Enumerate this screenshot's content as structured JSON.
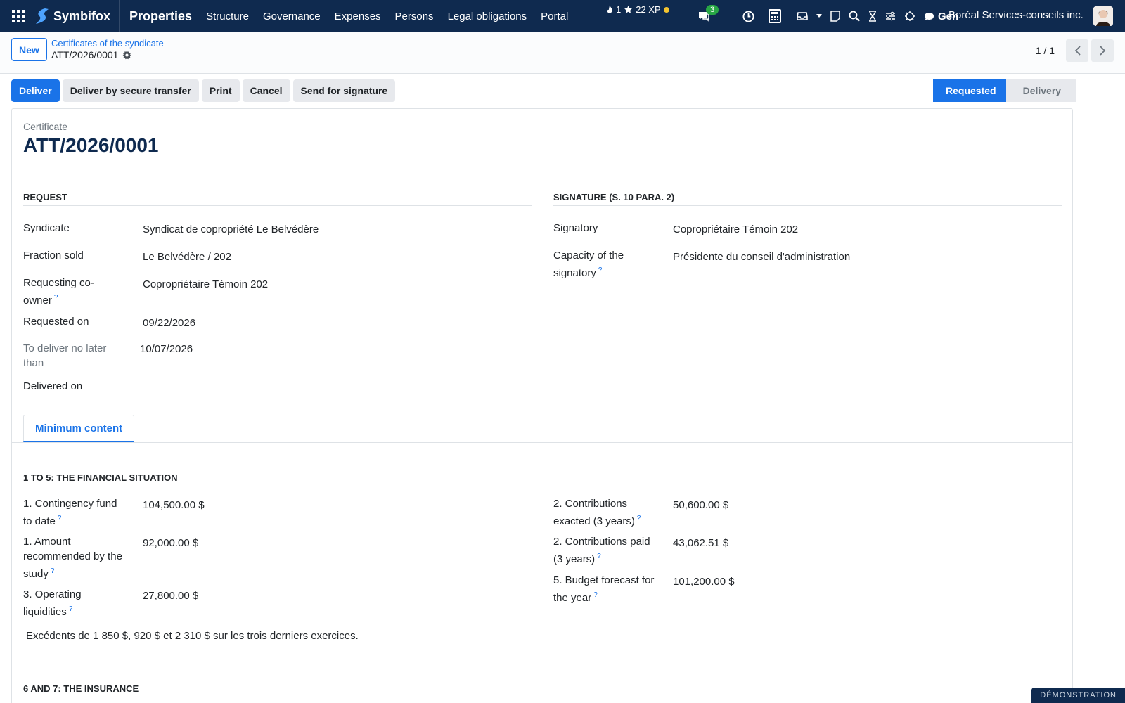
{
  "nav": {
    "brand": "Symbifox",
    "app_name": "Properties",
    "menu": [
      "Structure",
      "Governance",
      "Expenses",
      "Persons",
      "Legal obligations",
      "Portal"
    ],
    "xp_count": "1",
    "xp_points": "22 XP",
    "chat_badge": "3",
    "gen_label": "Gen",
    "company": "Boréal Services-conseils inc."
  },
  "control": {
    "new_label": "New",
    "breadcrumb_parent": "Certificates of the syndicate",
    "breadcrumb_current": "ATT/2026/0001",
    "pager": "1 / 1"
  },
  "statusbar": {
    "buttons": [
      "Deliver",
      "Deliver by secure transfer",
      "Print",
      "Cancel",
      "Send for signature"
    ],
    "stages": [
      "Requested",
      "Delivery"
    ]
  },
  "record": {
    "label": "Certificate",
    "title": "ATT/2026/0001"
  },
  "request": {
    "heading": "Request",
    "syndicate_label": "Syndicate",
    "syndicate_value": "Syndicat de copropriété Le Belvédère",
    "fraction_label": "Fraction sold",
    "fraction_value": "Le Belvédère / 202",
    "coowner_label_1": "Requesting co-",
    "coowner_label_2": "owner",
    "coowner_value": "Copropriétaire Témoin 202",
    "requested_label": "Requested on",
    "requested_value": "09/22/2026",
    "deliver_by_label_1": "To deliver no later",
    "deliver_by_label_2": "than",
    "deliver_by_value": "10/07/2026",
    "delivered_label": "Delivered on"
  },
  "signature": {
    "heading": "Signature (s. 10 para. 2)",
    "signatory_label": "Signatory",
    "signatory_value": "Copropriétaire Témoin 202",
    "capacity_label_1": "Capacity of the",
    "capacity_label_2": "signatory",
    "capacity_value": "Présidente du conseil d'administration"
  },
  "tabs": {
    "minimum_content": "Minimum content"
  },
  "financial": {
    "heading": "1 to 5: The financial situation",
    "f1_label_1": "1. Contingency fund",
    "f1_label_2": "to date",
    "f1_value": "104,500.00 $",
    "f2_label_1": "1. Amount",
    "f2_label_2": "recommended by the",
    "f2_label_3": "study",
    "f2_value": "92,000.00 $",
    "f3_label_1": "3. Operating",
    "f3_label_2": "liquidities",
    "f3_value": "27,800.00 $",
    "f4_label_1": "2. Contributions",
    "f4_label_2": "exacted (3 years)",
    "f4_value": "50,600.00 $",
    "f5_label_1": "2. Contributions paid",
    "f5_label_2": "(3 years)",
    "f5_value": "43,062.51 $",
    "f6_label_1": "5. Budget forecast for",
    "f6_label_2": "the year",
    "f6_value": "101,200.00 $",
    "note": "Excédents de 1 850 $, 920 $ et 2 310 $ sur les trois derniers exercices."
  },
  "insurance": {
    "heading": "6 and 7: The insurance"
  },
  "ribbon": "DÉMONSTRATION",
  "help_mark": "?"
}
